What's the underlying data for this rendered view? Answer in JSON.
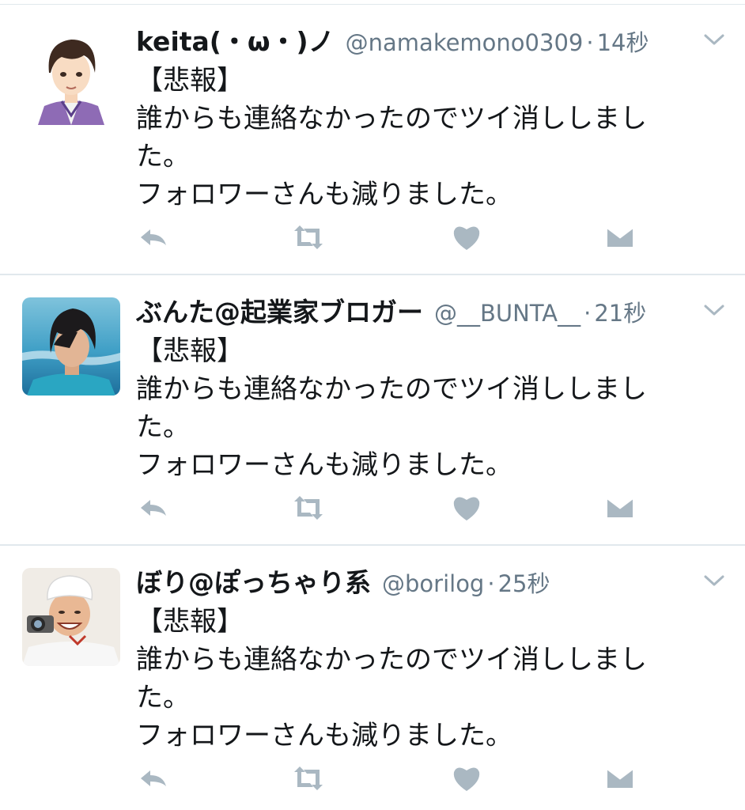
{
  "colors": {
    "text": "#14171a",
    "secondary": "#657786",
    "icon": "#aab8c2",
    "divider": "#e1e8ed"
  },
  "tweets": [
    {
      "name": "keita(・ω・)ノ",
      "handle": "@namakemono0309",
      "dot": "·",
      "time": "14秒",
      "lines": [
        "【悲報】",
        "誰からも連絡なかったのでツイ消ししまし",
        "た。",
        "フォロワーさんも減りました。"
      ],
      "avatar": "anime-style man in purple kimono"
    },
    {
      "name": "ぶんた@起業家ブロガー",
      "handle": "@__BUNTA__",
      "dot": "·",
      "time": "21秒",
      "lines": [
        "【悲報】",
        "誰からも連絡なかったのでツイ消ししまし",
        "た。",
        "フォロワーさんも減りました。"
      ],
      "avatar": "man with dark hair by the sea"
    },
    {
      "name": "ぼり@ぽっちゃり系",
      "handle": "@borilog",
      "dot": "·",
      "time": "25秒",
      "lines": [
        "【悲報】",
        "誰からも連絡なかったのでツイ消ししまし",
        "た。",
        "フォロワーさんも減りました。"
      ],
      "avatar": "smiling man in chef hat holding camera"
    }
  ],
  "icons": {
    "caret": "chevron-down-icon",
    "reply": "reply-icon",
    "retweet": "retweet-icon",
    "like": "heart-icon",
    "dm": "direct-message-icon"
  }
}
